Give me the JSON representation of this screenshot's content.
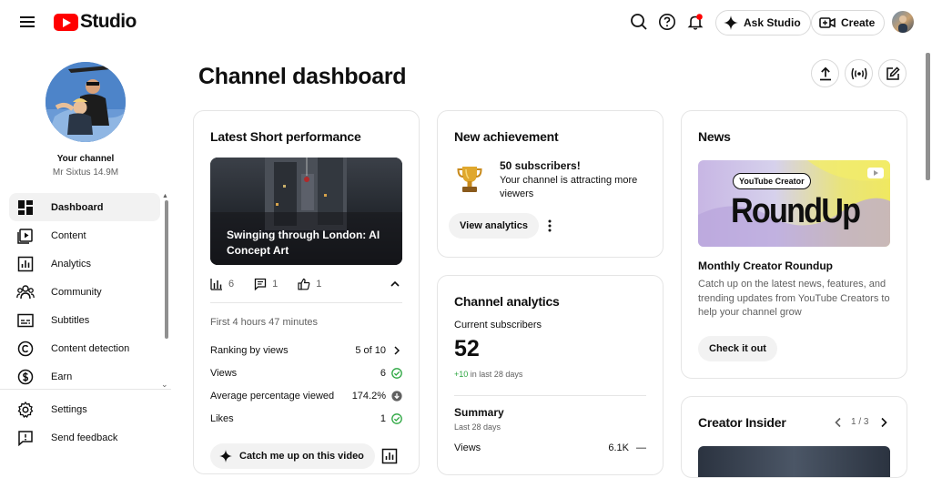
{
  "topbar": {
    "logo_text": "Studio",
    "ask_studio_label": "Ask Studio",
    "create_label": "Create"
  },
  "sidebar": {
    "channel_label": "Your channel",
    "channel_name": "Mr Sixtus 14.9M",
    "items": [
      {
        "label": "Dashboard",
        "icon": "dashboard-icon",
        "active": true
      },
      {
        "label": "Content",
        "icon": "content-icon"
      },
      {
        "label": "Analytics",
        "icon": "analytics-icon"
      },
      {
        "label": "Community",
        "icon": "community-icon"
      },
      {
        "label": "Subtitles",
        "icon": "subtitles-icon"
      },
      {
        "label": "Content detection",
        "icon": "copyright-icon"
      },
      {
        "label": "Earn",
        "icon": "dollar-icon"
      }
    ],
    "bottom_items": [
      {
        "label": "Settings",
        "icon": "gear-icon"
      },
      {
        "label": "Send feedback",
        "icon": "feedback-icon"
      }
    ]
  },
  "main": {
    "title": "Channel dashboard"
  },
  "latest_short": {
    "title": "Latest Short performance",
    "video_title": "Swinging through London: AI Concept Art",
    "views_count": "6",
    "comments_count": "1",
    "likes_count": "1",
    "first_period": "First 4 hours 47 minutes",
    "rows": [
      {
        "label": "Ranking by views",
        "value": "5 of 10"
      },
      {
        "label": "Views",
        "value": "6"
      },
      {
        "label": "Average percentage viewed",
        "value": "174.2%"
      },
      {
        "label": "Likes",
        "value": "1"
      }
    ],
    "catch_up_label": "Catch me up on this video"
  },
  "achievement": {
    "title": "New achievement",
    "headline": "50 subscribers!",
    "description": "Your channel is attracting more viewers",
    "button_label": "View analytics"
  },
  "channel_analytics": {
    "title": "Channel analytics",
    "current_subscribers_label": "Current subscribers",
    "subscribers_value": "52",
    "change_value": "+10",
    "change_period": "in last 28 days",
    "summary_title": "Summary",
    "summary_period": "Last 28 days",
    "views_label": "Views",
    "views_value": "6.1K",
    "views_trend": "—"
  },
  "news": {
    "title": "News",
    "badge_text": "YouTube Creator",
    "image_text": "RoundUp",
    "headline": "Monthly Creator Roundup",
    "description": "Catch up on the latest news, features, and trending updates from YouTube Creators to help your channel grow",
    "button_label": "Check it out"
  },
  "creator_insider": {
    "title": "Creator Insider",
    "pager": "1 / 3"
  },
  "colors": {
    "accent_red": "#ff0000",
    "success_green": "#2ba640",
    "text_primary": "#0f0f0f",
    "text_secondary": "#606060"
  }
}
